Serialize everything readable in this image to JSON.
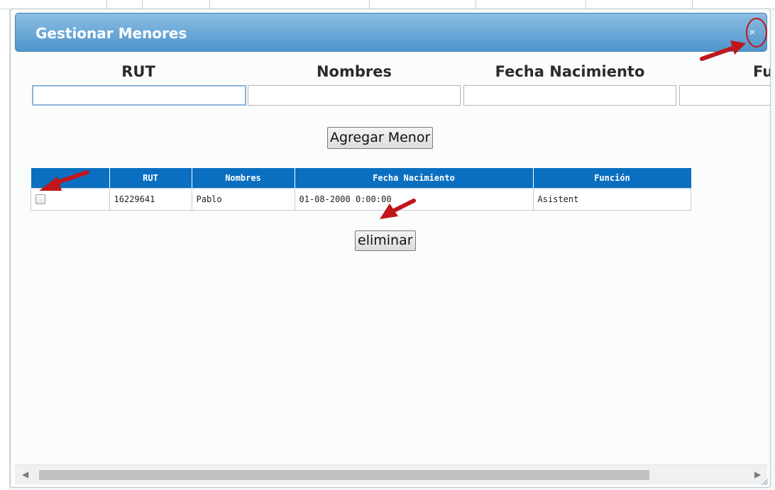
{
  "dialog": {
    "title": "Gestionar Menores",
    "close_label": "×"
  },
  "form": {
    "headers": [
      "RUT",
      "Nombres",
      "Fecha Nacimiento",
      "Fu"
    ],
    "values": [
      "",
      "",
      "",
      ""
    ],
    "add_button": "Agregar Menor"
  },
  "table": {
    "columns": [
      "",
      "RUT",
      "Nombres",
      "Fecha Nacimiento",
      "Función"
    ],
    "rows": [
      {
        "checked": false,
        "rut": "16229641",
        "nombres": "Pablo",
        "fecha": "01-08-2000 0:00:00",
        "funcion": "Asistent"
      }
    ]
  },
  "delete_button": "eliminar",
  "scrollbar": {
    "left_arrow": "◀",
    "right_arrow": "▶"
  },
  "colors": {
    "title_bar": "#4f95cc",
    "table_header": "#0a6fc0",
    "annotation": "#c0161c"
  }
}
